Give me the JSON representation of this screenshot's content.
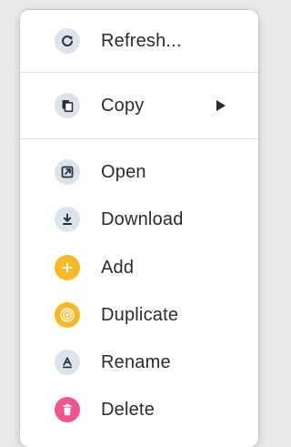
{
  "menu": {
    "items": [
      {
        "label": "Refresh...",
        "icon": "refresh-icon",
        "icon_bg": "#dde3ea"
      },
      {
        "label": "Copy",
        "icon": "copy-icon",
        "icon_bg": "#dde3ea",
        "has_submenu": true
      },
      {
        "label": "Open",
        "icon": "open-external-icon",
        "icon_bg": "#dde3ea"
      },
      {
        "label": "Download",
        "icon": "download-icon",
        "icon_bg": "#dde3ea"
      },
      {
        "label": "Add",
        "icon": "plus-icon",
        "icon_bg": "#f7b928"
      },
      {
        "label": "Duplicate",
        "icon": "duplicate-icon",
        "icon_bg": "#f7b928"
      },
      {
        "label": "Rename",
        "icon": "rename-icon",
        "icon_bg": "#dde3ea"
      },
      {
        "label": "Delete",
        "icon": "trash-icon",
        "icon_bg": "#f0568e"
      }
    ]
  },
  "colors": {
    "neutral_icon_bg": "#dde3ea",
    "accent_yellow": "#f7b928",
    "danger_pink": "#f0568e",
    "text": "#2b2b2e"
  }
}
